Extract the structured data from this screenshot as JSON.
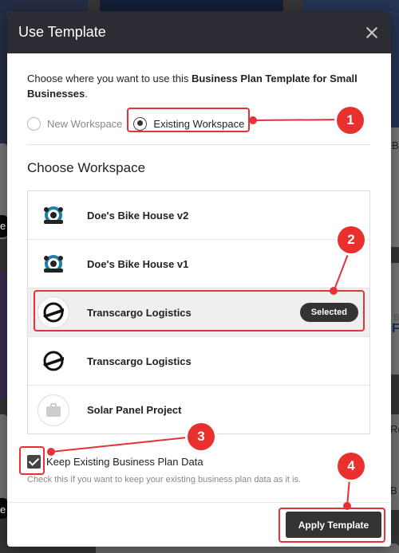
{
  "background": {
    "left_edge_labels": [
      "e",
      "ati",
      "e"
    ],
    "right_edge_labels": [
      "B",
      "B",
      "Ro",
      "B",
      "F"
    ]
  },
  "modal": {
    "title": "Use Template",
    "intro_prefix": "Choose where you want to use this ",
    "intro_bold": "Business Plan Template for Small Businesses",
    "intro_suffix": ".",
    "options": {
      "new_label": "New Workspace",
      "existing_label": "Existing Workspace",
      "selected": "existing"
    },
    "section_title": "Choose Workspace",
    "workspaces": [
      {
        "name": "Doe's Bike House v2",
        "icon": "bike-logo-icon",
        "selected": false
      },
      {
        "name": "Doe's Bike House v1",
        "icon": "bike-logo-icon",
        "selected": false
      },
      {
        "name": "Transcargo Logistics",
        "icon": "transcargo-logo-icon",
        "selected": true
      },
      {
        "name": "Transcargo Logistics",
        "icon": "transcargo-logo-icon",
        "selected": false
      },
      {
        "name": "Solar Panel Project",
        "icon": "briefcase-icon",
        "selected": false
      }
    ],
    "selected_badge": "Selected",
    "keep_data": {
      "label": "Keep Existing Business Plan Data",
      "help": "Check this if you want to keep your existing business plan data as it is.",
      "checked": true
    },
    "apply_label": "Apply Template"
  },
  "annotations": [
    {
      "number": "1"
    },
    {
      "number": "2"
    },
    {
      "number": "3"
    },
    {
      "number": "4"
    }
  ],
  "colors": {
    "header": "#2c2c34",
    "annotation": "#e53238",
    "button": "#333333"
  }
}
